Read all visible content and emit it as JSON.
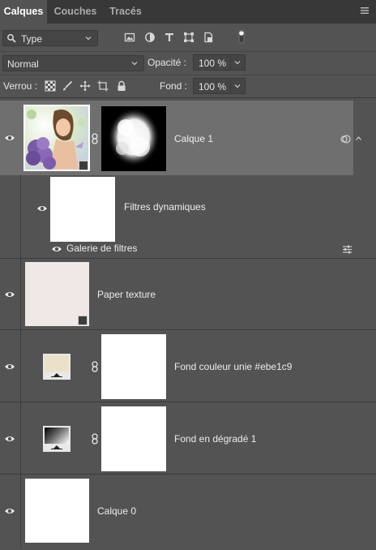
{
  "tabs": [
    {
      "label": "Calques",
      "active": true
    },
    {
      "label": "Couches",
      "active": false
    },
    {
      "label": "Tracés",
      "active": false
    }
  ],
  "panel_menu_icon": "hamburger-icon",
  "filter": {
    "kind_label": "Type",
    "icons": [
      "image-filter-icon",
      "adjustment-filter-icon",
      "type-filter-icon",
      "shape-filter-icon",
      "smart-object-filter-icon",
      "filter-toggle-icon"
    ]
  },
  "blend": {
    "mode": "Normal",
    "opacity_label": "Opacité :",
    "opacity_value": "100 %"
  },
  "lock": {
    "label": "Verrou :",
    "icons": [
      "lock-transparent-pixels-icon",
      "lock-image-pixels-icon",
      "lock-position-icon",
      "lock-artboard-icon",
      "lock-all-icon"
    ],
    "fill_label": "Fond :",
    "fill_value": "100 %"
  },
  "layers": [
    {
      "name": "Calque 1",
      "selected": true,
      "type": "smart-object-with-mask"
    },
    {
      "name": "Filtres dynamiques",
      "type": "smart-filters",
      "sub_filter": "Galerie de filtres"
    },
    {
      "name": "Paper texture",
      "type": "smart-object",
      "color": "#f0e8e6"
    },
    {
      "name": "Fond couleur unie #ebe1c9",
      "type": "solid-fill",
      "color": "#ebe1c9"
    },
    {
      "name": "Fond en dégradé 1",
      "type": "gradient-fill"
    },
    {
      "name": "Calque 0",
      "type": "pixel"
    }
  ],
  "colors": {
    "panel_bg": "#535353",
    "tab_bar": "#383838",
    "selected_row": "#6f6f6f",
    "solid_fill_swatch": "#ebe1c9"
  }
}
